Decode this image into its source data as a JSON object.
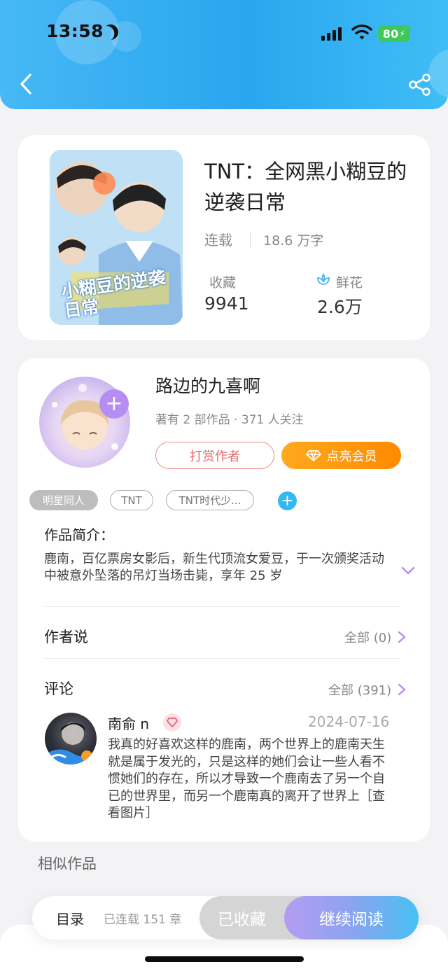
{
  "status_bar": {
    "time": "13:58",
    "battery": "80"
  },
  "book": {
    "title": "TNT：全网黑小糊豆的逆袭日常",
    "status": "连载",
    "word_count": "18.6 万字",
    "collect_label": "收藏",
    "collect_value": "9941",
    "flower_label": "鲜花",
    "flower_value": "2.6万",
    "cover_text": "小糊豆的逆袭日常"
  },
  "author": {
    "name": "路边的九喜啊",
    "meta": "著有 2 部作品 · 371 人关注",
    "tip_label": "打赏作者",
    "vip_label": "点亮会员"
  },
  "tags": [
    "明星同人",
    "TNT",
    "TNT时代少..."
  ],
  "intro": {
    "title": "作品简介：",
    "text": "鹿南，百亿票房女影后，新生代顶流女爱豆，于一次颁奖活动中被意外坠落的吊灯当场击毙，享年 25 岁"
  },
  "author_says": {
    "title": "作者说",
    "all_label": "全部 (0)"
  },
  "comments": {
    "title": "评论",
    "all_label": "全部 (391)",
    "items": [
      {
        "user": "南俞 n",
        "date": "2024-07-16",
        "text": "我真的好喜欢这样的鹿南，两个世界上的鹿南天生就是属于发光的，只是这样的她们会让一些人看不惯她们的存在，所以才导致一个鹿南去了另一个自已的世界里，而另一个鹿南真的离开了世界上［查看图片］"
      }
    ]
  },
  "similar_title": "相似作品",
  "bottom_bar": {
    "toc_label": "目录",
    "chapters": "已连载 151 章",
    "collected_label": "已收藏",
    "read_label": "继续阅读"
  },
  "colors": {
    "header": "#2aa6ef",
    "vip_orange": "#ff9a0e",
    "tip_red": "#e46b6b",
    "tag_add": "#33b8f2",
    "chevron": "#b68df0"
  }
}
